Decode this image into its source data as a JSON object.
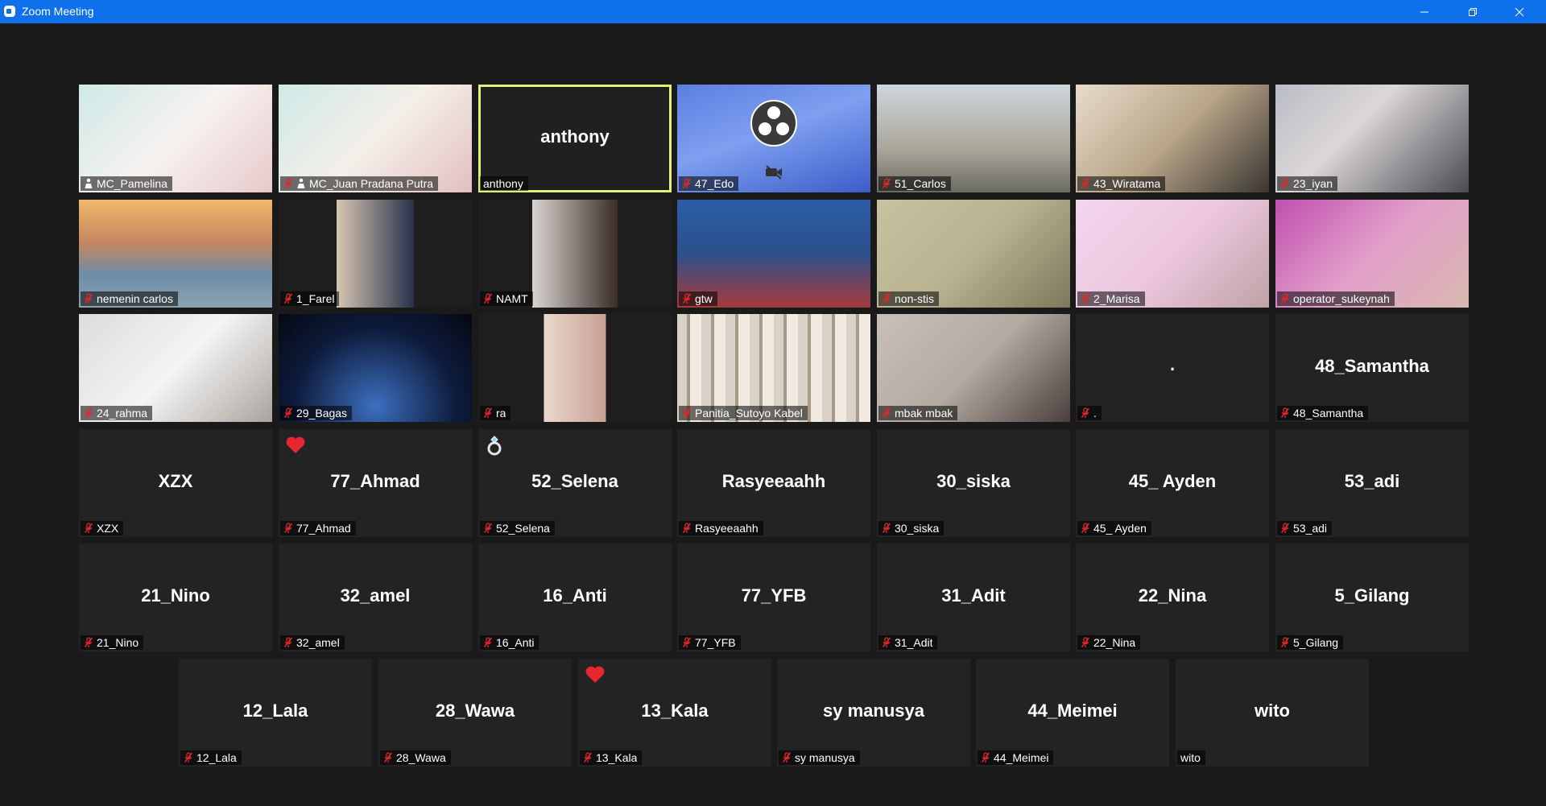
{
  "window": {
    "title": "Zoom Meeting"
  },
  "colors": {
    "titlebar": "#0e71eb",
    "active_speaker_border": "#e6f076",
    "mute_icon": "#e02828",
    "reaction_heart": "#e8262f"
  },
  "participants": [
    {
      "name": "MC_Pamelina",
      "display": "",
      "video": true,
      "muted": false,
      "icon": "person-pin-icon"
    },
    {
      "name": "MC_Juan Pradana Putra",
      "display": "",
      "video": true,
      "muted": true,
      "icon": "person-pin-icon"
    },
    {
      "name": "anthony",
      "display": "anthony",
      "video": false,
      "muted": false,
      "active": true
    },
    {
      "name": "47_Edo",
      "display": "",
      "video": true,
      "muted": true
    },
    {
      "name": "51_Carlos",
      "display": "",
      "video": true,
      "muted": true
    },
    {
      "name": "43_Wiratama",
      "display": "",
      "video": true,
      "muted": true
    },
    {
      "name": "23_iyan",
      "display": "",
      "video": true,
      "muted": true
    },
    {
      "name": "nemenin carlos",
      "display": "",
      "video": true,
      "muted": true
    },
    {
      "name": "1_Farel",
      "display": "",
      "video": true,
      "muted": true
    },
    {
      "name": "NAMT",
      "display": "",
      "video": true,
      "muted": true
    },
    {
      "name": "gtw",
      "display": "",
      "video": true,
      "muted": true
    },
    {
      "name": "non-stis",
      "display": "",
      "video": true,
      "muted": true
    },
    {
      "name": "2_Marisa",
      "display": "",
      "video": true,
      "muted": true
    },
    {
      "name": "operator_sukeynah",
      "display": "",
      "video": true,
      "muted": true
    },
    {
      "name": "24_rahma",
      "display": "",
      "video": true,
      "muted": true
    },
    {
      "name": "29_Bagas",
      "display": "",
      "video": true,
      "muted": true
    },
    {
      "name": "ra",
      "display": "",
      "video": true,
      "muted": true
    },
    {
      "name": "Panitia_Sutoyo Kabel",
      "display": "",
      "video": true,
      "muted": true
    },
    {
      "name": "mbak mbak",
      "display": "",
      "video": true,
      "muted": true
    },
    {
      "name": ".",
      "display": ".",
      "video": false,
      "muted": true
    },
    {
      "name": "48_Samantha",
      "display": "48_Samantha",
      "video": false,
      "muted": true
    },
    {
      "name": "XZX",
      "display": "XZX",
      "video": false,
      "muted": true
    },
    {
      "name": "77_Ahmad",
      "display": "77_Ahmad",
      "video": false,
      "muted": true,
      "reaction": "heart"
    },
    {
      "name": "52_Selena",
      "display": "52_Selena",
      "video": false,
      "muted": true,
      "reaction": "ring"
    },
    {
      "name": "Rasyeeaahh",
      "display": "Rasyeeaahh",
      "video": false,
      "muted": true
    },
    {
      "name": "30_siska",
      "display": "30_siska",
      "video": false,
      "muted": true
    },
    {
      "name": "45_ Ayden",
      "display": "45_ Ayden",
      "video": false,
      "muted": true
    },
    {
      "name": "53_adi",
      "display": "53_adi",
      "video": false,
      "muted": true
    },
    {
      "name": "21_Nino",
      "display": "21_Nino",
      "video": false,
      "muted": true
    },
    {
      "name": "32_amel",
      "display": "32_amel",
      "video": false,
      "muted": true
    },
    {
      "name": "16_Anti",
      "display": "16_Anti",
      "video": false,
      "muted": true
    },
    {
      "name": "77_YFB",
      "display": "77_YFB",
      "video": false,
      "muted": true
    },
    {
      "name": "31_Adit",
      "display": "31_Adit",
      "video": false,
      "muted": true
    },
    {
      "name": "22_Nina",
      "display": "22_Nina",
      "video": false,
      "muted": true
    },
    {
      "name": "5_Gilang",
      "display": "5_Gilang",
      "video": false,
      "muted": true
    },
    {
      "name": "12_Lala",
      "display": "12_Lala",
      "video": false,
      "muted": true
    },
    {
      "name": "28_Wawa",
      "display": "28_Wawa",
      "video": false,
      "muted": true
    },
    {
      "name": "13_Kala",
      "display": "13_Kala",
      "video": false,
      "muted": true,
      "reaction": "heart"
    },
    {
      "name": "sy manusya",
      "display": "sy manusya",
      "video": false,
      "muted": true
    },
    {
      "name": "44_Meimei",
      "display": "44_Meimei",
      "video": false,
      "muted": true
    },
    {
      "name": "wito",
      "display": "wito",
      "video": false,
      "muted": false
    }
  ]
}
